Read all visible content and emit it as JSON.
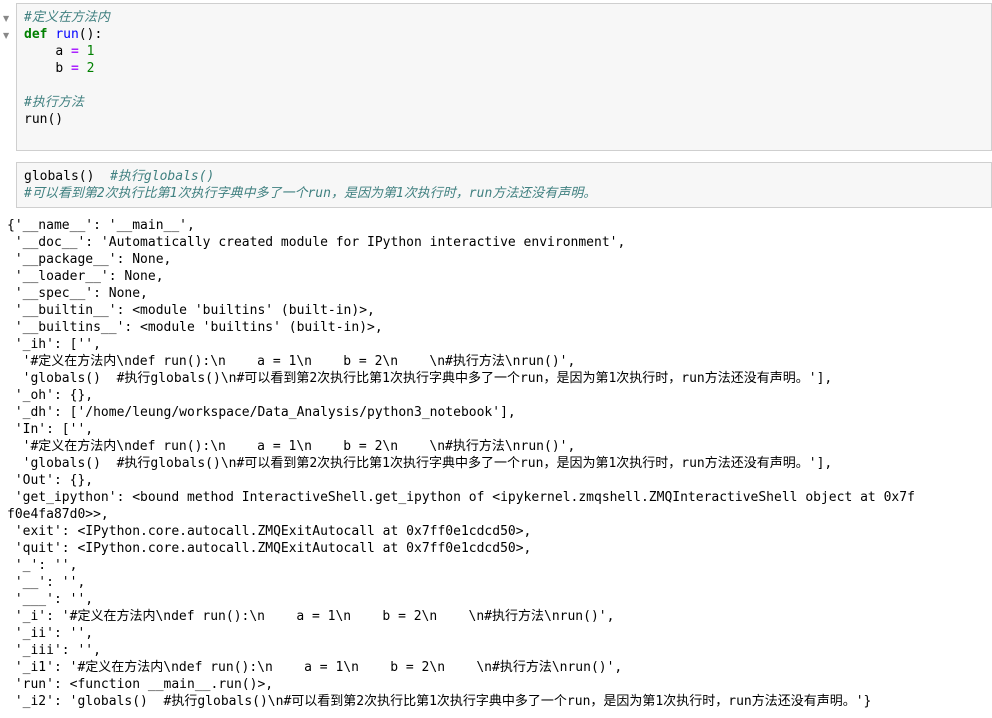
{
  "cell1": {
    "arrows": [
      "▼",
      "▼"
    ],
    "line1_comment": "#定义在方法内",
    "line2": {
      "kw": "def",
      "space": " ",
      "name": "run",
      "rest": "():"
    },
    "line3": {
      "indent": "    ",
      "var": "a",
      "sp1": " ",
      "op": "=",
      "sp2": " ",
      "num": "1"
    },
    "line4": {
      "indent": "    ",
      "var": "b",
      "sp1": " ",
      "op": "=",
      "sp2": " ",
      "num": "2"
    },
    "line6_comment": "#执行方法",
    "line7": "run()"
  },
  "cell2": {
    "line1": {
      "code": "globals()",
      "gap": "  ",
      "comment": "#执行globals()"
    },
    "line2_comment": "#可以看到第2次执行比第1次执行字典中多了一个run，是因为第1次执行时，run方法还没有声明。"
  },
  "output": {
    "lines": [
      "{'__name__': '__main__',",
      " '__doc__': 'Automatically created module for IPython interactive environment',",
      " '__package__': None,",
      " '__loader__': None,",
      " '__spec__': None,",
      " '__builtin__': <module 'builtins' (built-in)>,",
      " '__builtins__': <module 'builtins' (built-in)>,",
      " '_ih': ['',",
      "  '#定义在方法内\\ndef run():\\n    a = 1\\n    b = 2\\n    \\n#执行方法\\nrun()',",
      "  'globals()  #执行globals()\\n#可以看到第2次执行比第1次执行字典中多了一个run，是因为第1次执行时，run方法还没有声明。'],",
      " '_oh': {},",
      " '_dh': ['/home/leung/workspace/Data_Analysis/python3_notebook'],",
      " 'In': ['',",
      "  '#定义在方法内\\ndef run():\\n    a = 1\\n    b = 2\\n    \\n#执行方法\\nrun()',",
      "  'globals()  #执行globals()\\n#可以看到第2次执行比第1次执行字典中多了一个run，是因为第1次执行时，run方法还没有声明。'],",
      " 'Out': {},",
      " 'get_ipython': <bound method InteractiveShell.get_ipython of <ipykernel.zmqshell.ZMQInteractiveShell object at 0x7f",
      "f0e4fa87d0>>,",
      " 'exit': <IPython.core.autocall.ZMQExitAutocall at 0x7ff0e1cdcd50>,",
      " 'quit': <IPython.core.autocall.ZMQExitAutocall at 0x7ff0e1cdcd50>,",
      " '_': '',",
      " '__': '',",
      " '___': '',",
      " '_i': '#定义在方法内\\ndef run():\\n    a = 1\\n    b = 2\\n    \\n#执行方法\\nrun()',",
      " '_ii': '',",
      " '_iii': '',",
      " '_i1': '#定义在方法内\\ndef run():\\n    a = 1\\n    b = 2\\n    \\n#执行方法\\nrun()',",
      " 'run': <function __main__.run()>,",
      " '_i2': 'globals()  #执行globals()\\n#可以看到第2次执行比第1次执行字典中多了一个run，是因为第1次执行时，run方法还没有声明。'}"
    ]
  },
  "colors": {
    "cell_background": "#f7f7f7",
    "cell_border": "#cfcfcf",
    "comment": "#408080",
    "keyword": "#008000",
    "function_name": "#0000ff",
    "operator": "#aa22ff",
    "number": "#008000"
  }
}
